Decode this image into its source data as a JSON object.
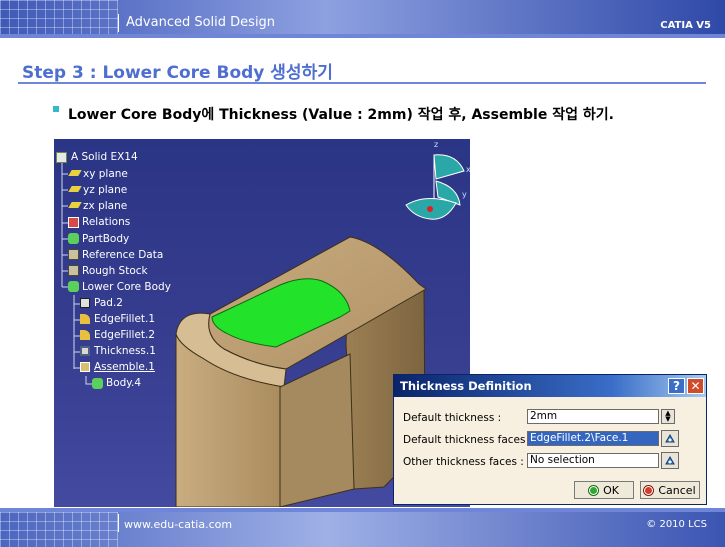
{
  "header": {
    "title": "Advanced Solid Design",
    "brand": "CATIA V5"
  },
  "step_title": "Step 3 : Lower Core Body 생성하기",
  "instruction": "Lower Core Body에 Thickness (Value : 2mm) 작업 후, Assemble 작업 하기.",
  "tree": {
    "items": [
      {
        "label": "A Solid EX14",
        "icon": "part-icon"
      },
      {
        "label": "xy plane",
        "icon": "plane-icon"
      },
      {
        "label": "yz plane",
        "icon": "plane-icon"
      },
      {
        "label": "zx plane",
        "icon": "plane-icon"
      },
      {
        "label": "Relations",
        "icon": "relations-icon"
      },
      {
        "label": "PartBody",
        "icon": "body-icon"
      },
      {
        "label": "Reference Data",
        "icon": "geometrical-set-icon"
      },
      {
        "label": "Rough Stock",
        "icon": "geometrical-set-icon"
      },
      {
        "label": "Lower Core Body",
        "icon": "body-icon"
      },
      {
        "label": "Pad.2",
        "icon": "pad-icon"
      },
      {
        "label": "EdgeFillet.1",
        "icon": "fillet-icon"
      },
      {
        "label": "EdgeFillet.2",
        "icon": "fillet-icon"
      },
      {
        "label": "Thickness.1",
        "icon": "thickness-icon"
      },
      {
        "label": "Assemble.1",
        "icon": "assemble-icon"
      },
      {
        "label": "Body.4",
        "icon": "body-icon"
      }
    ]
  },
  "compass": {
    "z_label": "z",
    "x_label": "x",
    "y_label": "y"
  },
  "dialog": {
    "title": "Thickness Definition",
    "help_label": "?",
    "close_label": "✕",
    "default_thickness_label": "Default thickness :",
    "default_thickness_value": "2mm",
    "default_faces_label": "Default thickness faces :",
    "default_faces_value": "EdgeFillet.2\\Face.1",
    "other_faces_label": "Other thickness faces :",
    "other_faces_value": "No selection",
    "ok_label": "OK",
    "cancel_label": "Cancel"
  },
  "footer": {
    "url": "www.edu-catia.com",
    "copyright": "© 2010 LCS"
  },
  "colors": {
    "accent": "#4f6fd0",
    "viewport_bg": "#383e90",
    "model": "#b8996a",
    "face_highlight": "#22e22a"
  }
}
